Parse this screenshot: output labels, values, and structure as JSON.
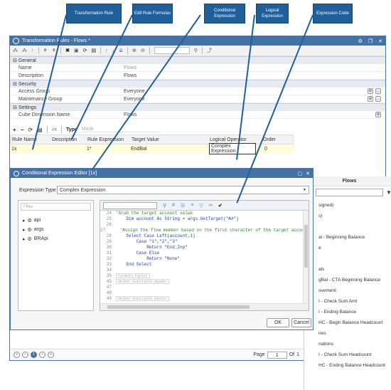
{
  "callouts": {
    "c1": "Transformation Rule",
    "c2": "Edit Rule Formulas",
    "c3": "Conditional Expression",
    "c4": "Logical Expression",
    "c5": "Expression Code"
  },
  "window": {
    "title": "Transformation Rules - Flows *",
    "controls": [
      "gear",
      "restore",
      "close"
    ]
  },
  "props": {
    "general": "General",
    "name_k": "Name",
    "name_v": "Flows",
    "desc_k": "Description",
    "desc_v": "Flows",
    "security": "Security",
    "ag_k": "Access Group",
    "ag_v": "Everyone",
    "mg_k": "Maintenance Group",
    "mg_v": "Everyone",
    "settings": "Settings",
    "cdn_k": "Cube Dimension Name",
    "cdn_v": "Flows"
  },
  "gridbar": {
    "type_label": "Type",
    "type_value": "Mask"
  },
  "grid": {
    "headers": [
      "Rule Name",
      "Description",
      "Rule Expression",
      "Target Value",
      "Logical Operator",
      "Order"
    ],
    "row": [
      "1x",
      "",
      "1*",
      "EndBal",
      "Complex Expression",
      "0"
    ]
  },
  "dialog": {
    "title": "Conditional Expression Editor  [1x]",
    "etype_label": "Expression Type",
    "etype_value": "Complex Expression",
    "filter_ph": "Filter",
    "tree": [
      "api",
      "args",
      "BRApi"
    ],
    "ok": "OK",
    "cancel": "Cancel"
  },
  "code": {
    "lines": [
      {
        "n": "24",
        "t": "'Grab the target account value"
      },
      {
        "n": "25",
        "t": "    Dim account As String = args.GetTarget(\"A#\")"
      },
      {
        "n": "26",
        "t": ""
      },
      {
        "n": "27",
        "t": "    'Assign the flow member based on the first character of the target account"
      },
      {
        "n": "28",
        "t": "    Select Case Left(account,1)"
      },
      {
        "n": "29",
        "t": "        Case \"1\",\"2\",\"3\""
      },
      {
        "n": "30",
        "t": "            Return \"End_Inp\""
      },
      {
        "n": "31",
        "t": "        Case Else"
      },
      {
        "n": "32",
        "t": "            Return \"None\""
      },
      {
        "n": "33",
        "t": "    End Select"
      },
      {
        "n": "34",
        "t": ""
      },
      {
        "n": "35",
        "t": ""
      },
      {
        "n": "45",
        "t": ""
      },
      {
        "n": "47",
        "t": ""
      },
      {
        "n": "48",
        "t": ""
      },
      {
        "n": "49",
        "t": ""
      }
    ],
    "helpers": [
      "Formula Footer",
      "Helper Functions Header",
      "Helper Functions Footer"
    ]
  },
  "flows": {
    "title": "Flows",
    "items": [
      "signed)",
      "s)",
      "",
      "al - Beginning Balance",
      "e",
      "",
      "als",
      "gBal - CTA Beginning Balance",
      "ovement",
      "I - Check Sum Amt",
      "I - Ending Balance",
      "HC - Begin Balance Headcount",
      "ires",
      "nations",
      "I - Check Sum Headcount",
      "HC - Ending Balance Headcount"
    ]
  },
  "pager": {
    "page_label": "Page",
    "page_value": "1",
    "of_label": "Of",
    "of_value": "1",
    "current": "1"
  }
}
